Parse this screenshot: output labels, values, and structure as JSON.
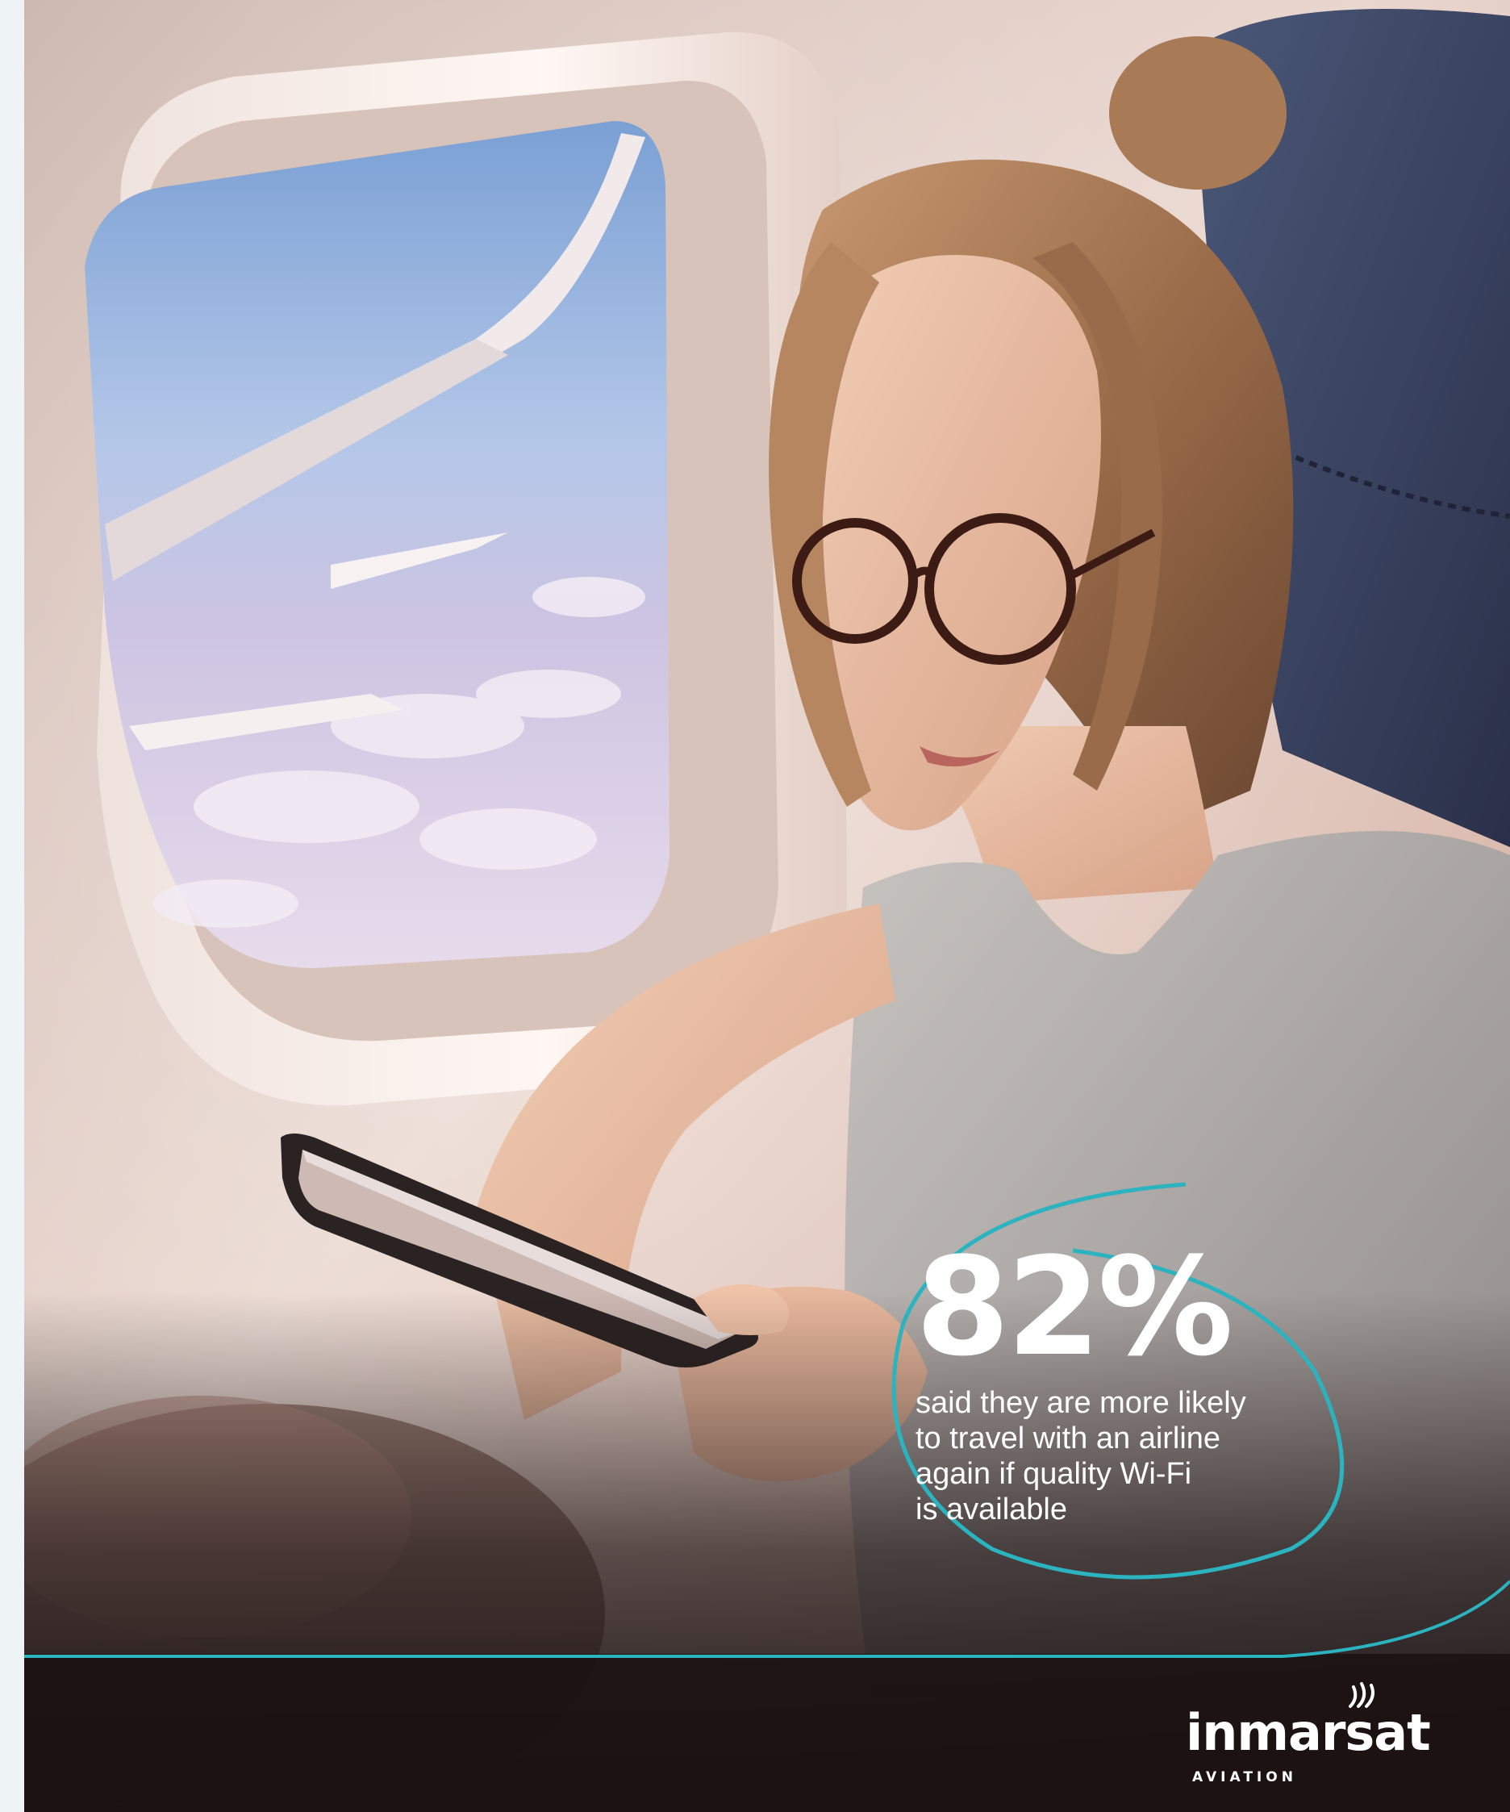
{
  "stat": {
    "value": "82%",
    "caption_lines": [
      "said they are more likely",
      "to travel with an airline",
      "again if quality Wi-Fi",
      "is available"
    ]
  },
  "brand": {
    "name": "inmarsat",
    "division": "AVIATION"
  },
  "colors": {
    "accent": "#2bb3c0",
    "text": "#ffffff",
    "margin": "#eef3f6"
  },
  "icons": {
    "logo_mark": "signal-waves-icon"
  }
}
